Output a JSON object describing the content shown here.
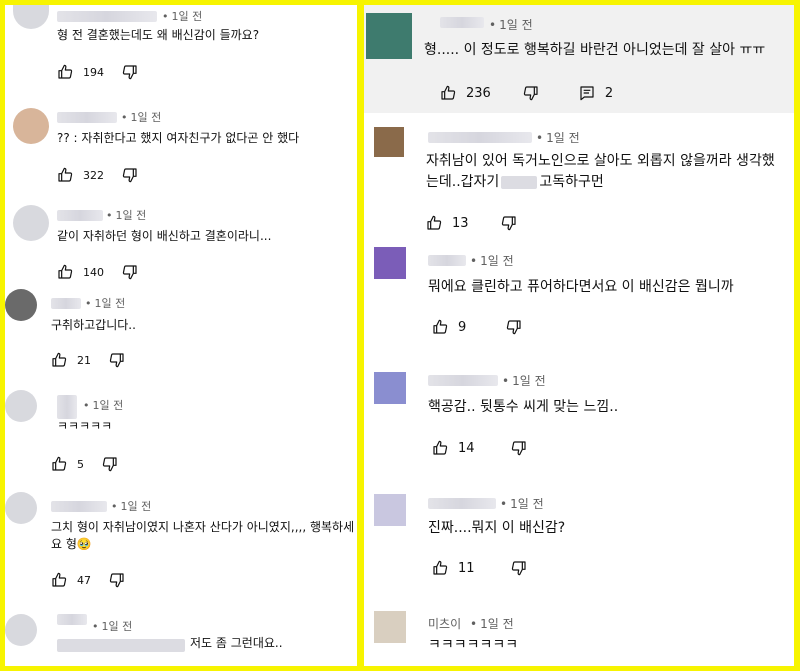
{
  "left": {
    "comments": [
      {
        "time": "1일 전",
        "text": "형 전 결혼했는데도 왜 배신감이 들까요?",
        "likes": "194"
      },
      {
        "time": "1일 전",
        "text": "?? : 자취한다고 했지 여자친구가 없다곤 안 했다",
        "likes": "322"
      },
      {
        "time": "1일 전",
        "text": "같이 자취하던 형이 배신하고 결혼이라니...",
        "likes": "140"
      },
      {
        "time": "1일 전",
        "text": "구취하고갑니다..",
        "likes": "21"
      },
      {
        "time": "1일 전",
        "text": "ㅋㅋㅋㅋㅋ",
        "likes": "5"
      },
      {
        "time": "1일 전",
        "text_line1": "그치 형이 자취남이였지 나혼자 산다가 아니였지,,,, 행복하세",
        "text_line2": "요 형🥹",
        "likes": "47"
      },
      {
        "time": "1일 전",
        "text": "저도 좀 그런대요.."
      }
    ]
  },
  "right": {
    "comments": [
      {
        "time": "1일 전",
        "text": "형..... 이 정도로 행복하길 바란건 아니었는데 잘 살아 ㅠㅠ",
        "likes": "236",
        "replies": "2"
      },
      {
        "time": "1일 전",
        "text_line1": "자취남이 있어 독거노인으로 살아도 외롭지 않을꺼라 생각했",
        "text_line2a": "는데..갑자기",
        "text_line2b": "고독하구먼",
        "likes": "13"
      },
      {
        "time": "1일 전",
        "text": "뭐에요 클린하고 퓨어하다면서요 이 배신감은 뭡니까",
        "likes": "9"
      },
      {
        "time": "1일 전",
        "text": "핵공감.. 뒷통수 씨게 맞는 느낌..",
        "likes": "14"
      },
      {
        "time": "1일 전",
        "text": "진짜....뭐지 이 배신감?",
        "likes": "11"
      },
      {
        "name": "미츠이",
        "time": "1일 전",
        "text": "ㅋㅋㅋㅋㅋㅋㅋ"
      }
    ]
  },
  "icons": {
    "like": "thumbs-up-icon",
    "dislike": "thumbs-down-icon",
    "reply": "reply-comment-icon"
  }
}
